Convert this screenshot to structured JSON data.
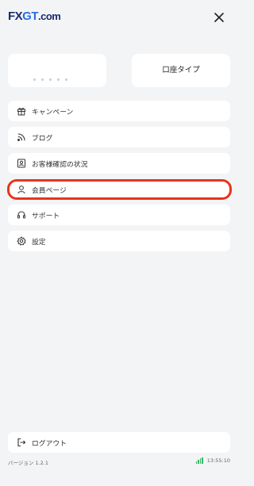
{
  "brand": {
    "logo_fx": "FX",
    "logo_gt": "GT",
    "logo_dom": ".com"
  },
  "account_card": {
    "label": "口座タイプ"
  },
  "menu": {
    "items": [
      {
        "label": "キャンペーン",
        "icon": "gift-icon"
      },
      {
        "label": "ブログ",
        "icon": "rss-icon"
      },
      {
        "label": "お客様確認の状況",
        "icon": "id-badge-icon"
      },
      {
        "label": "会員ページ",
        "icon": "user-icon"
      },
      {
        "label": "サポート",
        "icon": "headset-icon"
      },
      {
        "label": "設定",
        "icon": "gear-icon"
      }
    ],
    "logout_label": "ログアウト"
  },
  "footer": {
    "version": "バージョン 1.2.1",
    "time": "13:55:10",
    "signal_color": "#3ab56a"
  },
  "colors": {
    "brand_navy": "#1a2a6c",
    "brand_blue": "#2b6de8",
    "highlight": "#e8341c"
  }
}
